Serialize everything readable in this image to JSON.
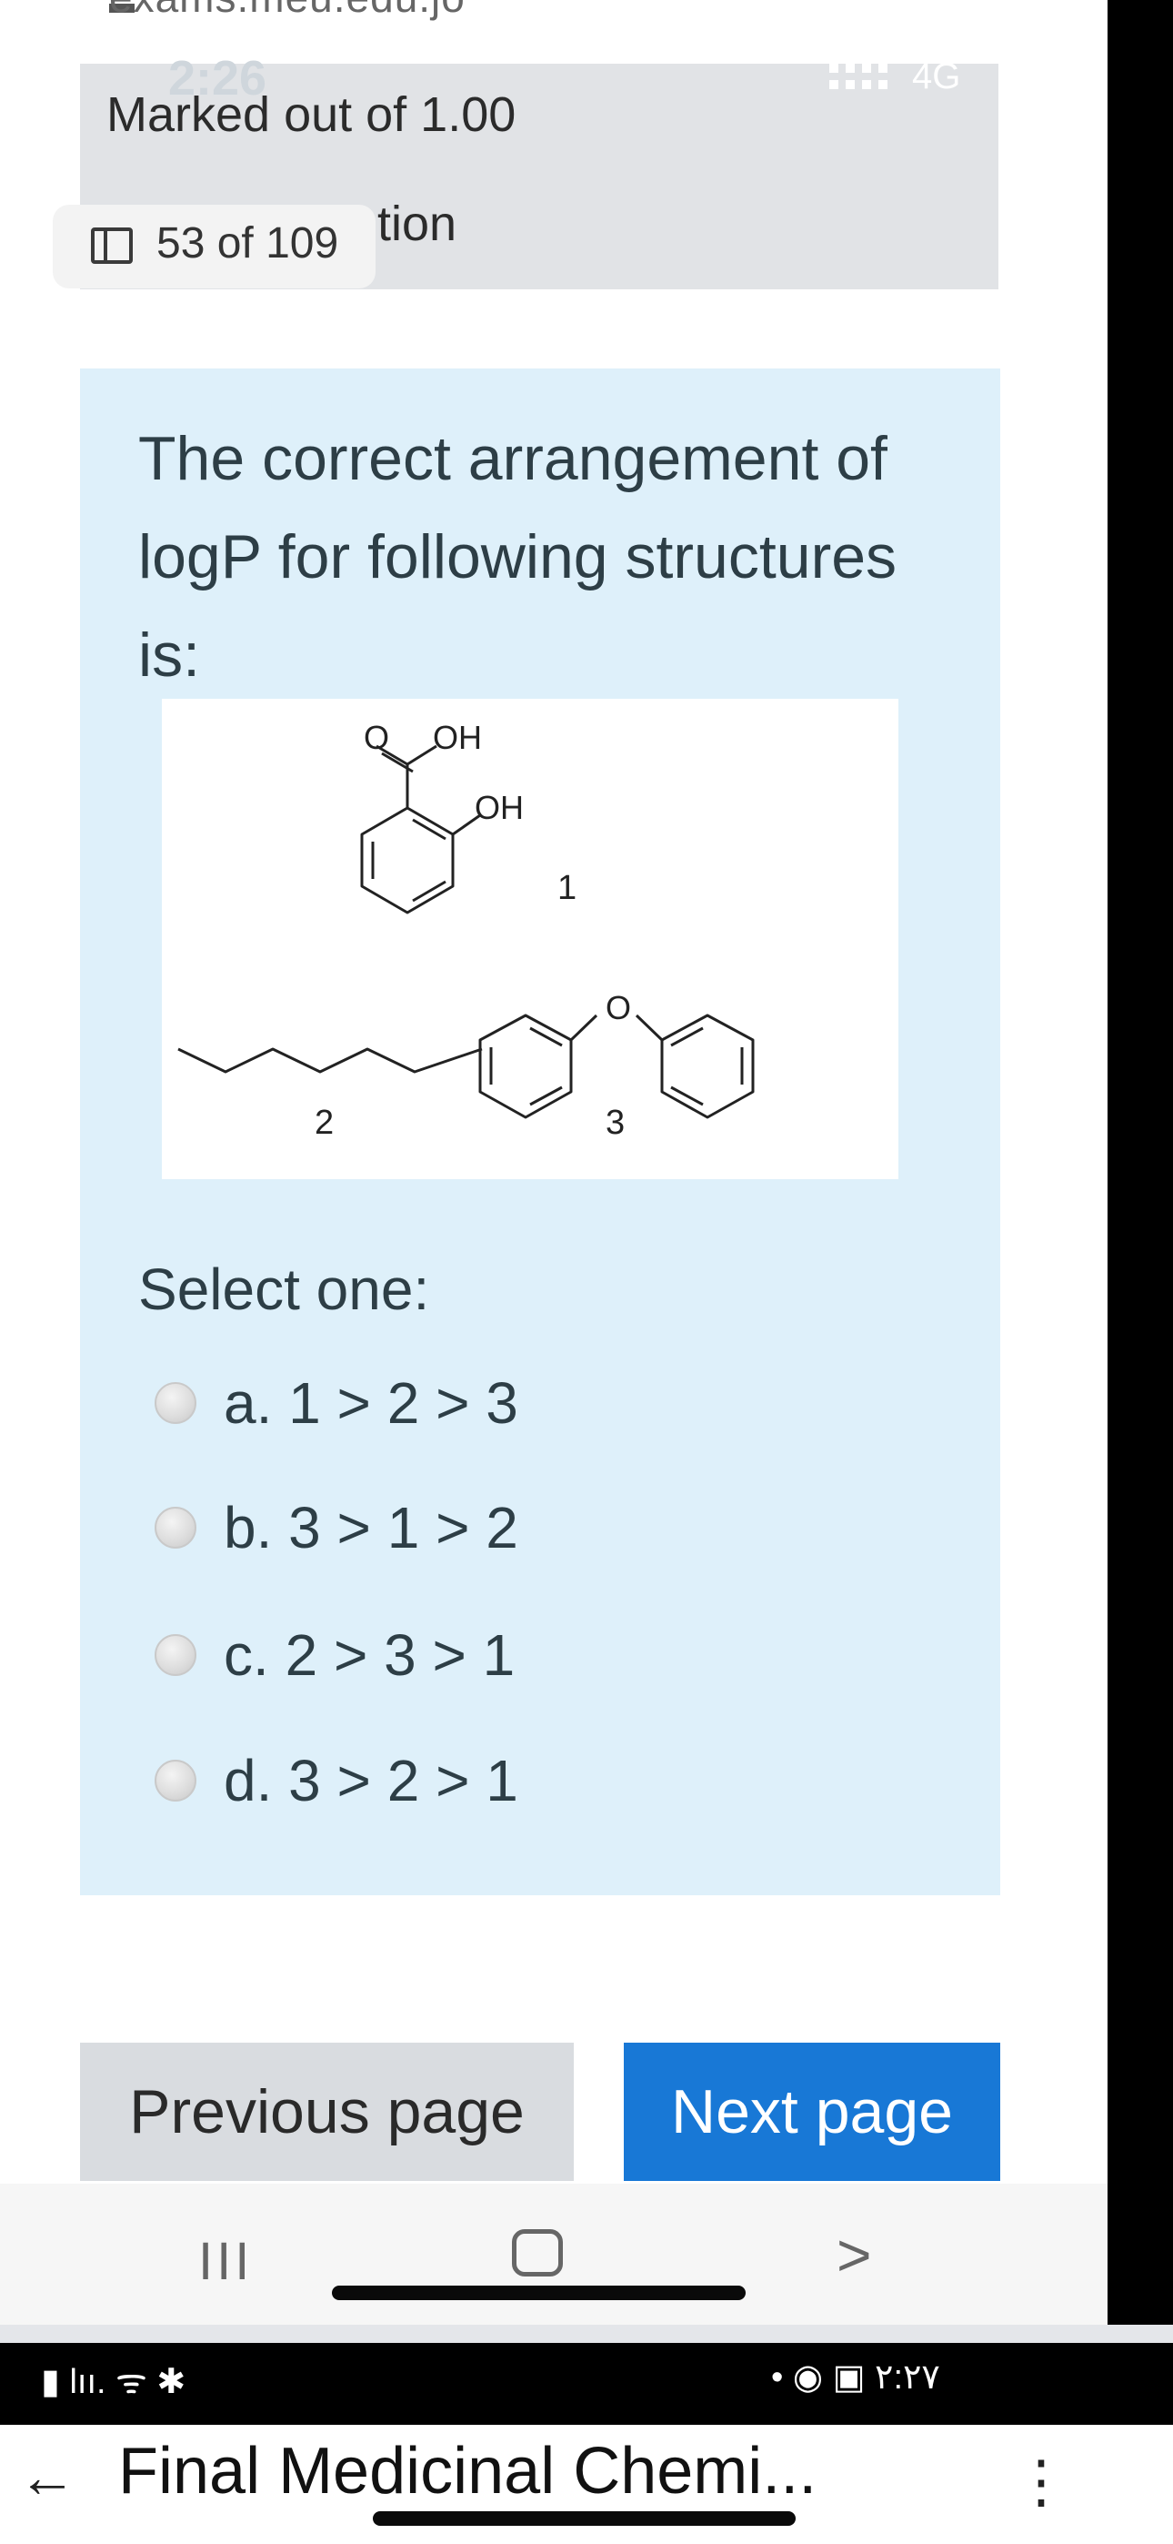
{
  "browser": {
    "url_fragment": "exams.meu.edu.jo"
  },
  "overlay_status": {
    "time": "2:26",
    "network": "4G"
  },
  "question_info": {
    "marked_out_of": "Marked out of 1.00",
    "counter": "53 of 109",
    "partial_word": "tion"
  },
  "question": {
    "text": "The correct arrangement of logP for following structures is:",
    "structures": {
      "labels": [
        "1",
        "2",
        "3"
      ],
      "atoms": {
        "carbonyl_o": "O",
        "acid_oh": "OH",
        "phenol_oh": "OH",
        "ether_o": "O"
      }
    },
    "select_prompt": "Select one:",
    "options": [
      {
        "label": "a. 1 > 2 > 3"
      },
      {
        "label": "b. 3 > 1 > 2"
      },
      {
        "label": "c. 2 > 3 > 1"
      },
      {
        "label": "d. 3 > 2 > 1"
      }
    ]
  },
  "navigation": {
    "previous": "Previous page",
    "next": "Next page"
  },
  "android_nav": {
    "recent": "III",
    "back": ">"
  },
  "status_bar2": {
    "left": "▮ lıı. ᯤ ✱",
    "right": "• ◉ ▣ ٢:٢٧"
  },
  "app_bar": {
    "back": "←",
    "title": "Final Medicinal Chemi...",
    "menu": "⋮"
  }
}
